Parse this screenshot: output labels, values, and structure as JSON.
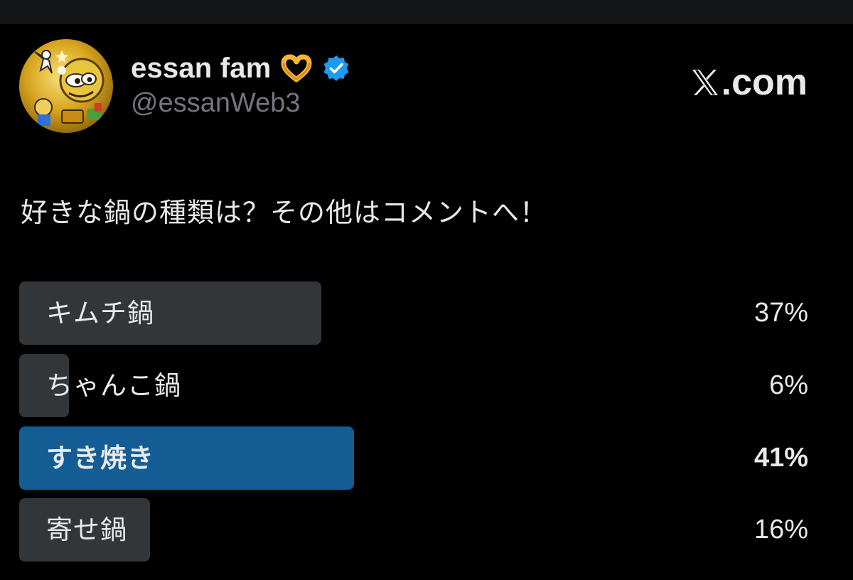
{
  "author": {
    "display_name": "essan fam",
    "handle": "@essanWeb3",
    "emoji_icon": "heart-hands-emoji",
    "verified_icon": "verified-badge-icon",
    "avatar_icon": "gold-avatar-image"
  },
  "brand": {
    "logo_icon": "x-logo-icon",
    "domain": ".com"
  },
  "post": {
    "text": "好きな鍋の種類は？その他はコメントへ！"
  },
  "poll": {
    "options": [
      {
        "label": "キムチ鍋",
        "percent_text": "37%",
        "percent": 37,
        "winner": false
      },
      {
        "label": "ちゃんこ鍋",
        "percent_text": "6%",
        "percent": 6,
        "winner": false
      },
      {
        "label": "すき焼き",
        "percent_text": "41%",
        "percent": 41,
        "winner": true
      },
      {
        "label": "寄せ鍋",
        "percent_text": "16%",
        "percent": 16,
        "winner": false
      }
    ]
  },
  "colors": {
    "background": "#000000",
    "bar": "#333639",
    "winner_bar": "#145c94",
    "text": "#e7e9ea",
    "muted": "#71767b",
    "verified": "#1d9bf0"
  }
}
